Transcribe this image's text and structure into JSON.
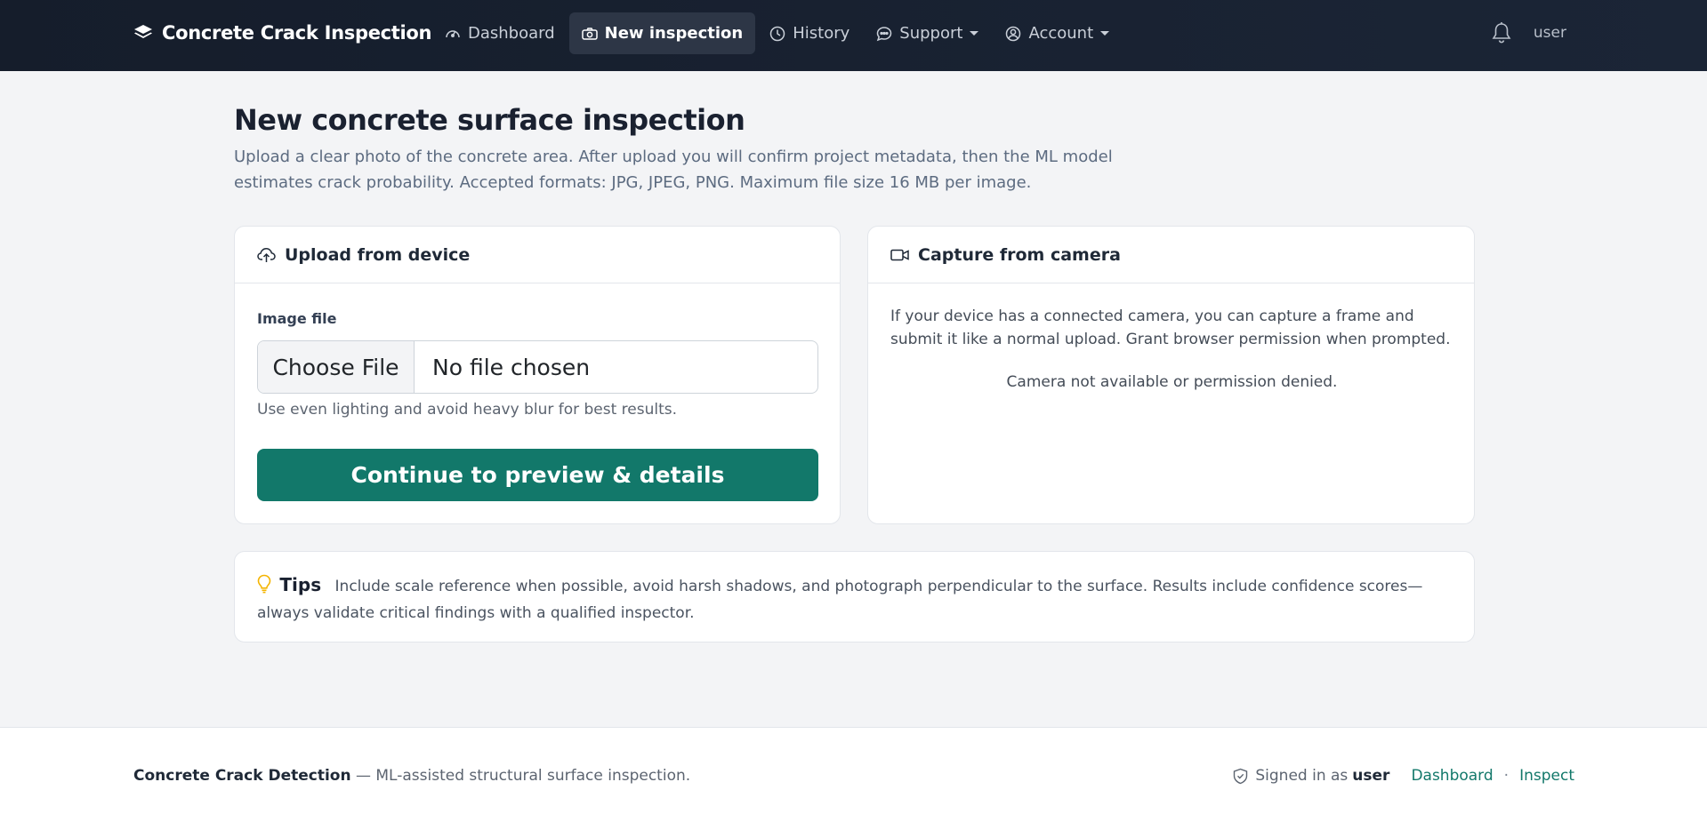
{
  "navbar": {
    "brand": "Concrete Crack Inspection",
    "links": [
      {
        "label": "Dashboard"
      },
      {
        "label": "New inspection"
      },
      {
        "label": "History"
      },
      {
        "label": "Support"
      },
      {
        "label": "Account"
      }
    ],
    "user": "user"
  },
  "page": {
    "title": "New concrete surface inspection",
    "description": "Upload a clear photo of the concrete area. After upload you will confirm project metadata, then the ML model estimates crack probability. Accepted formats: JPG, JPEG, PNG. Maximum file size 16 MB per image."
  },
  "upload": {
    "header": "Upload from device",
    "field_label": "Image file",
    "choose_button": "Choose File",
    "file_status": "No file chosen",
    "help": "Use even lighting and avoid heavy blur for best results.",
    "submit": "Continue to preview & details"
  },
  "camera": {
    "header": "Capture from camera",
    "description": "If your device has a connected camera, you can capture a frame and submit it like a normal upload. Grant browser permission when prompted.",
    "status": "Camera not available or permission denied."
  },
  "tips": {
    "title": "Tips",
    "text": "Include scale reference when possible, avoid harsh shadows, and photograph perpendicular to the surface. Results include confidence scores—always validate critical findings with a qualified inspector."
  },
  "footer": {
    "brand": "Concrete Crack Detection",
    "tagline": " — ML-assisted structural surface inspection.",
    "signed_in_prefix": "Signed in as",
    "signed_in_user": "user",
    "link_dashboard": "Dashboard",
    "separator": "·",
    "link_inspect": "Inspect"
  },
  "colors": {
    "navbar": "#151d2b",
    "accent": "#12786a",
    "tips_icon": "#f4b400"
  },
  "icons": {
    "brand": "layers-icon",
    "dashboard": "speedometer-icon",
    "new_inspection": "camera-icon",
    "history": "clock-icon",
    "support": "chat-icon",
    "account": "person-circle-icon",
    "notifications": "bell-icon",
    "upload": "cloud-upload-icon",
    "camera": "video-camera-icon",
    "tips": "lightbulb-icon",
    "footer": "shield-check-icon"
  }
}
